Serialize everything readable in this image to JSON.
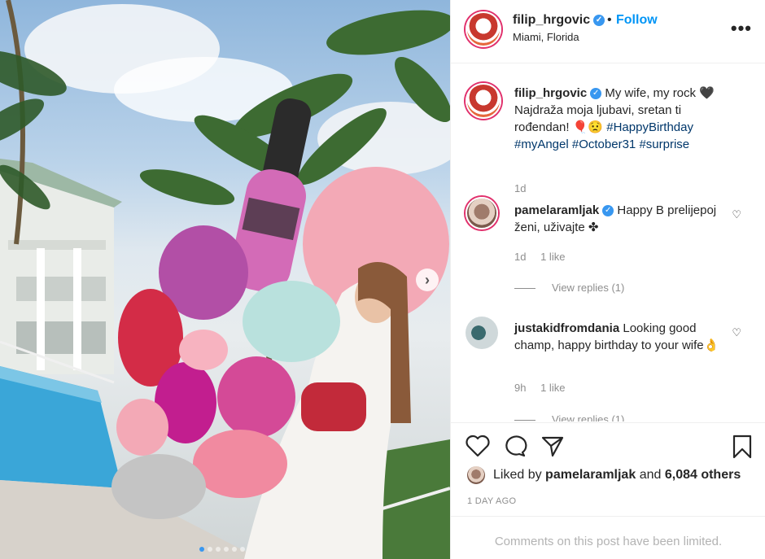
{
  "post": {
    "carousel_index": 0,
    "carousel_count": 6,
    "next_arrow": "›"
  },
  "header": {
    "username": "filip_hrgovic",
    "verified_mark": "✓",
    "dot": "•",
    "follow_label": "Follow",
    "location": "Miami, Florida",
    "more_label": "•••"
  },
  "caption": {
    "username": "filip_hrgovic",
    "text": " My wife, my rock 🖤 Najdraža moja ljubavi, sretan ti rođendan! 🎈😟 ",
    "hashtags": [
      "#HappyBirthday",
      "#myAngel",
      "#October31",
      "#surprise"
    ],
    "age": "1d"
  },
  "comments": [
    {
      "username": "pamelaramljak",
      "verified": true,
      "text": " Happy B prelijepoj ženi, uživajte ✤",
      "age": "1d",
      "likes": "1 like",
      "view_replies": "View replies (1)"
    },
    {
      "username": "justakidfromdania",
      "verified": false,
      "text": " Looking good champ, happy birthday to your wife👌",
      "age": "9h",
      "likes": "1 like",
      "view_replies": "View replies (1)"
    }
  ],
  "actions": {
    "icons": [
      "heart-icon",
      "comment-icon",
      "share-icon",
      "bookmark-icon"
    ]
  },
  "likes": {
    "prefix": "Liked by ",
    "user": "pamelaramljak",
    "middle": " and ",
    "others": "6,084 others"
  },
  "timestamp": "1 DAY AGO",
  "comments_limited": "Comments on this post have been limited.",
  "colors": {
    "link_blue": "#0095f6",
    "hashtag": "#00376b",
    "muted": "#8e8e8e",
    "border": "#efefef"
  }
}
